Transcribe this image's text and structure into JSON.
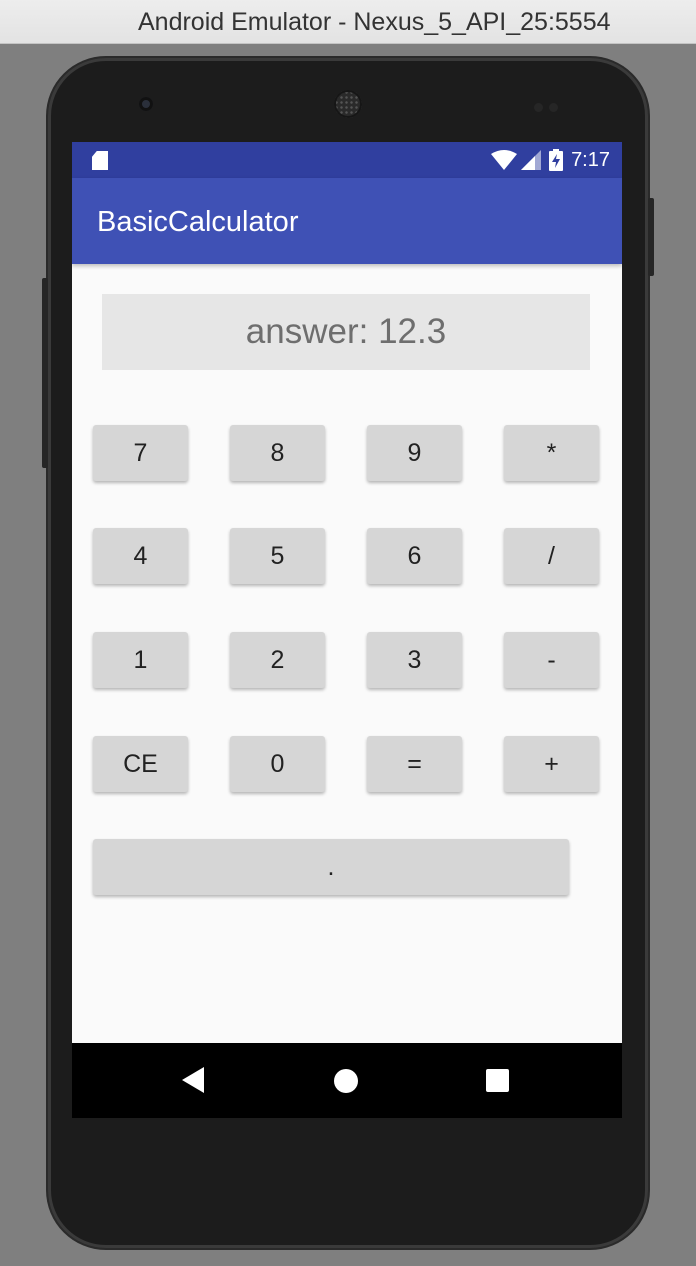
{
  "window": {
    "title": "Android Emulator - Nexus_5_API_25:5554"
  },
  "status_bar": {
    "time": "7:17",
    "icons": [
      "sd-card-icon",
      "wifi-icon",
      "signal-icon",
      "battery-charging-icon"
    ]
  },
  "app_bar": {
    "title": "BasicCalculator"
  },
  "display": {
    "text": "answer: 12.3"
  },
  "keypad": {
    "rows": [
      [
        "7",
        "8",
        "9",
        "*"
      ],
      [
        "4",
        "5",
        "6",
        "/"
      ],
      [
        "1",
        "2",
        "3",
        "-"
      ],
      [
        "CE",
        "0",
        "=",
        "+"
      ]
    ],
    "wide": "."
  },
  "nav_bar": {
    "icons": [
      "back-icon",
      "home-icon",
      "recents-icon"
    ]
  },
  "colors": {
    "status_bar": "#303f9f",
    "app_bar": "#3f51b5",
    "background": "#fafafa",
    "button": "#d6d6d6",
    "display_box": "#e6e6e6"
  }
}
